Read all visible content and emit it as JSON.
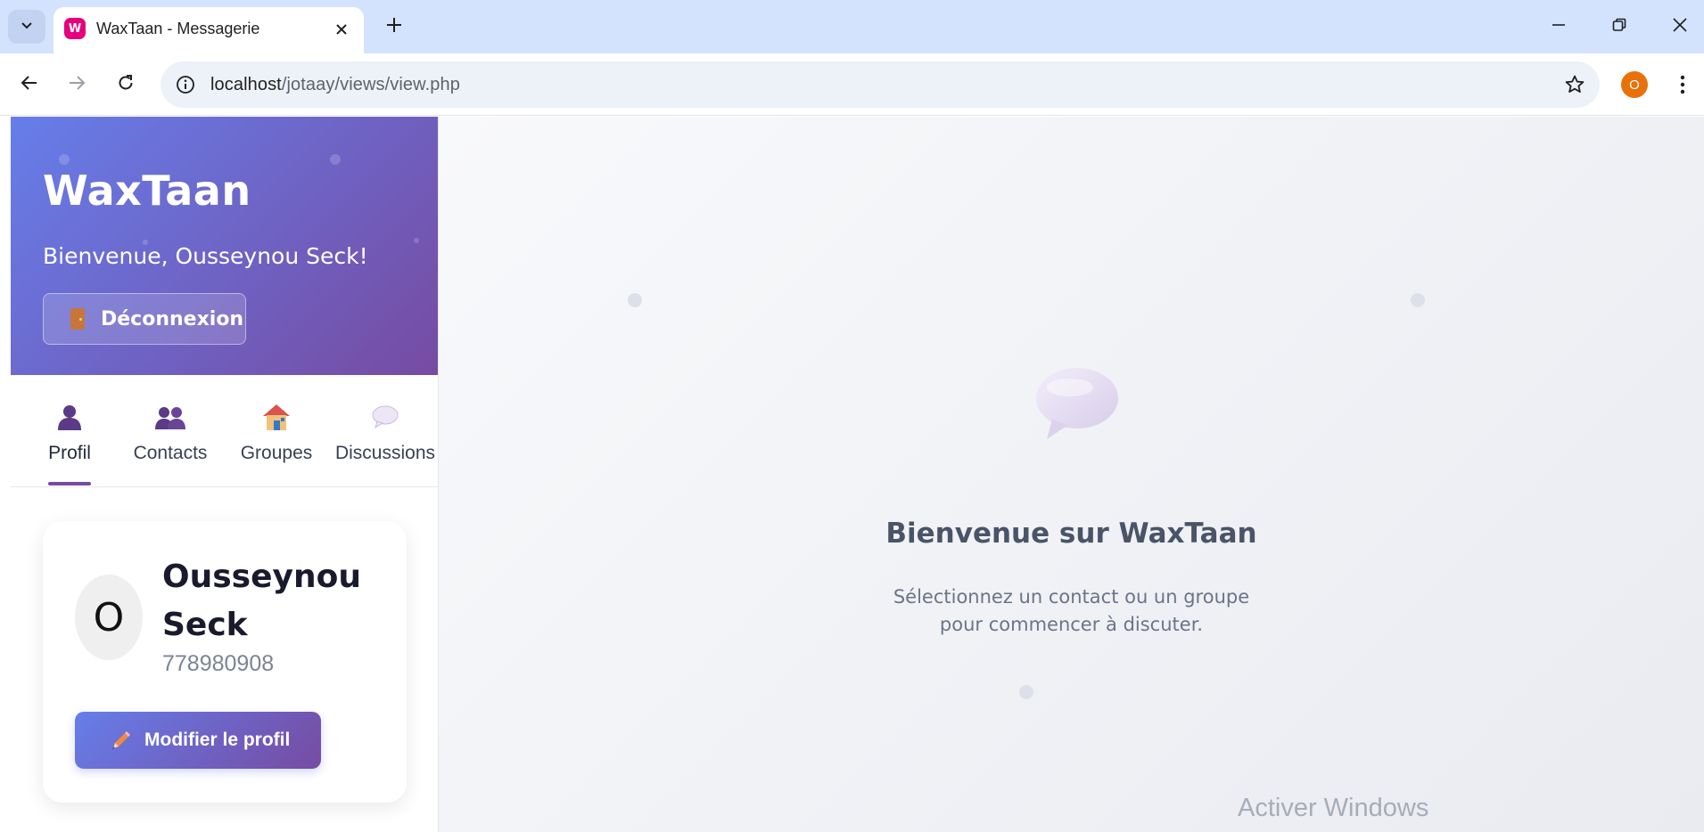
{
  "browser": {
    "tab_title": "WaxTaan - Messagerie",
    "favicon_letter": "W",
    "url_host": "localhost",
    "url_path": "/jotaay/views/view.php",
    "profile_initial": "O"
  },
  "sidebar": {
    "app_title": "WaxTaan",
    "welcome": "Bienvenue, Ousseynou Seck!",
    "logout_label": "Déconnexion",
    "tabs": [
      {
        "label": "Profil",
        "icon": "user-icon",
        "active": true
      },
      {
        "label": "Contacts",
        "icon": "contacts-icon",
        "active": false
      },
      {
        "label": "Groupes",
        "icon": "house-icon",
        "active": false
      },
      {
        "label": "Discussions",
        "icon": "speech-bubble-icon",
        "active": false
      }
    ],
    "profile": {
      "initial": "O",
      "name": "Ousseynou Seck",
      "phone": "778980908",
      "edit_label": "Modifier le profil"
    }
  },
  "main": {
    "title": "Bienvenue sur WaxTaan",
    "subtitle_line1": "Sélectionnez un contact ou un groupe",
    "subtitle_line2": "pour commencer à discuter."
  },
  "watermark": "Activer Windows",
  "colors": {
    "gradient_start": "#667eea",
    "gradient_end": "#764ba2",
    "browser_frame": "#d3e3fd",
    "favicon": "#e6007e",
    "profile_avatar": "#e8710a"
  }
}
